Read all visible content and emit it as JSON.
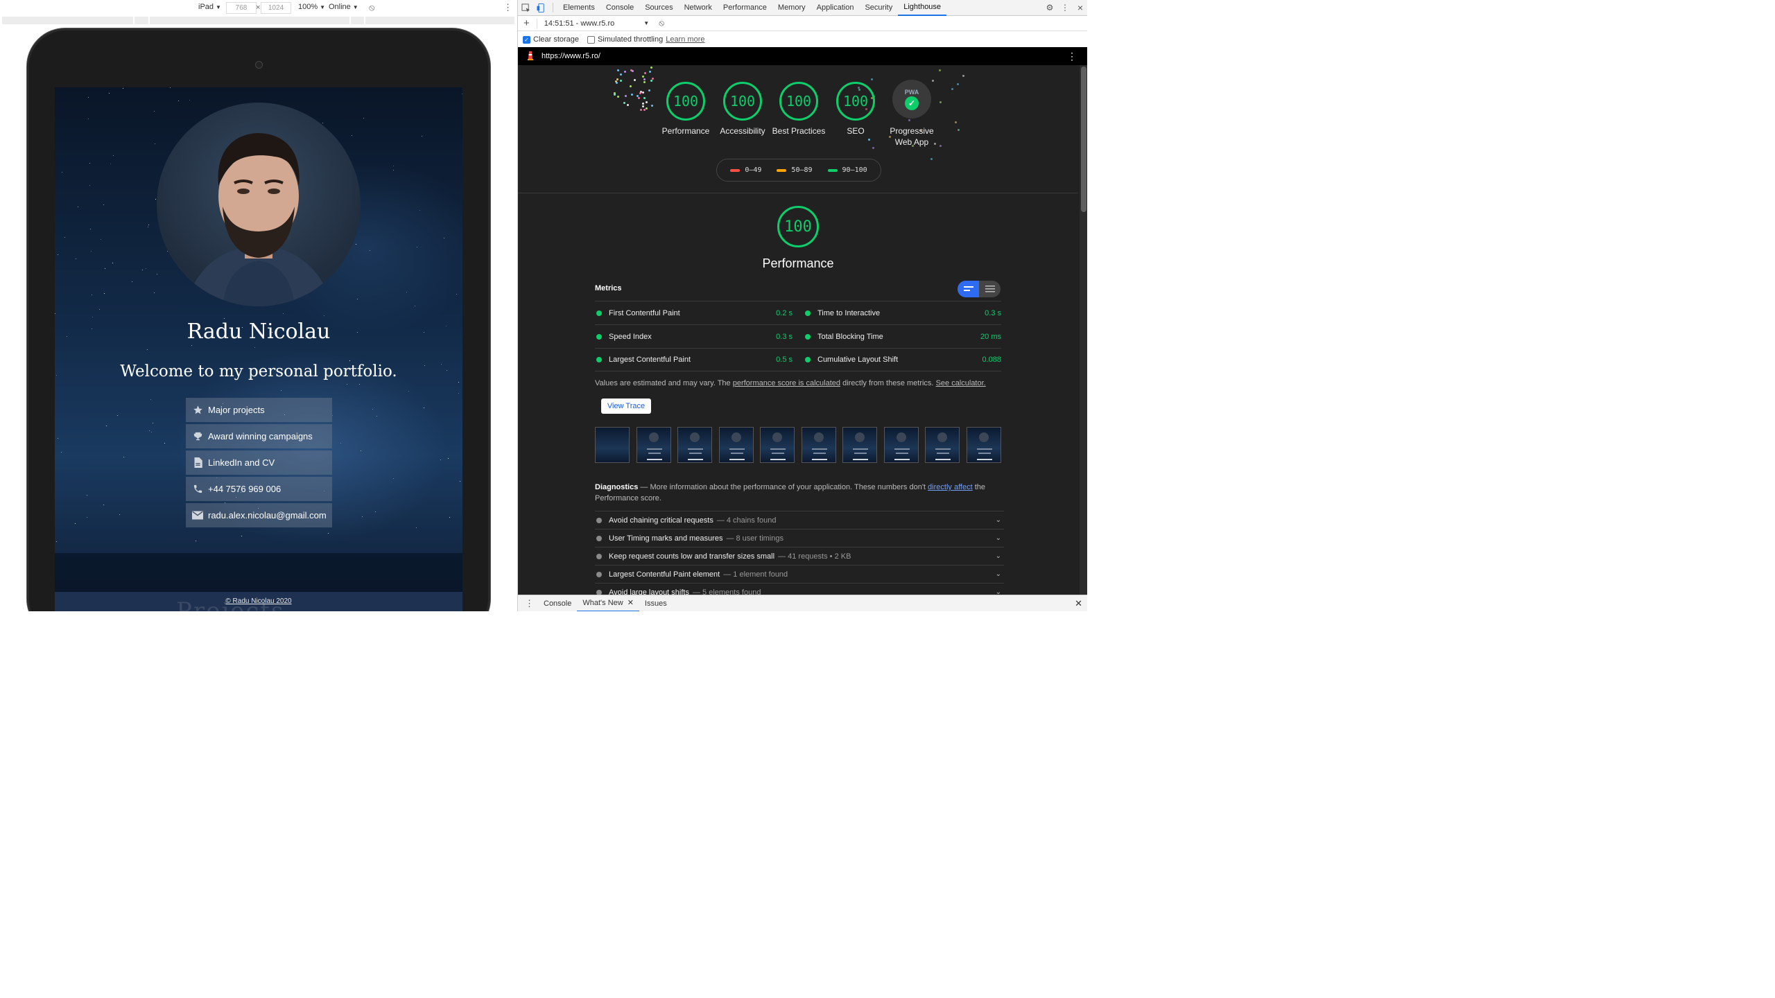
{
  "device_toolbar": {
    "device": "iPad",
    "width": "768",
    "times": "×",
    "height": "1024",
    "zoom": "100%",
    "network": "Online"
  },
  "site": {
    "name": "Radu Nicolau",
    "welcome": "Welcome to my personal portfolio.",
    "links": [
      {
        "label": "Major projects",
        "icon": "star-icon"
      },
      {
        "label": "Award winning campaigns",
        "icon": "trophy-icon"
      },
      {
        "label": "LinkedIn and CV",
        "icon": "document-icon"
      },
      {
        "label": "+44 7576 969 006",
        "icon": "phone-icon"
      },
      {
        "label": "radu.alex.nicolau@gmail.com",
        "icon": "mail-icon"
      }
    ],
    "footer": "© Radu Nicolau 2020",
    "footer_ghost": "Projects"
  },
  "devtools": {
    "tabs": [
      "Elements",
      "Console",
      "Sources",
      "Network",
      "Performance",
      "Memory",
      "Application",
      "Security",
      "Lighthouse"
    ],
    "active_tab": "Lighthouse",
    "report_select": "14:51:51 - www.r5.ro",
    "options": {
      "clear_storage": "Clear storage",
      "clear_storage_checked": true,
      "simulated_throttling": "Simulated throttling",
      "simulated_throttling_checked": false,
      "learn_more": "Learn more"
    },
    "report_url": "https://www.r5.ro/",
    "gauges": [
      {
        "label": "Performance",
        "score": "100"
      },
      {
        "label": "Accessibility",
        "score": "100"
      },
      {
        "label": "Best Practices",
        "score": "100"
      },
      {
        "label": "SEO",
        "score": "100"
      }
    ],
    "pwa": {
      "label": "Progressive Web App",
      "badge": "PWA"
    },
    "legend": [
      {
        "range": "0–49",
        "color": "#ff4e42"
      },
      {
        "range": "50–89",
        "color": "#ffa400"
      },
      {
        "range": "90–100",
        "color": "#0cce6b"
      }
    ],
    "performance": {
      "score": "100",
      "title": "Performance",
      "metrics_heading": "Metrics",
      "metrics": [
        {
          "name": "First Contentful Paint",
          "value": "0.2 s"
        },
        {
          "name": "Time to Interactive",
          "value": "0.3 s"
        },
        {
          "name": "Speed Index",
          "value": "0.3 s"
        },
        {
          "name": "Total Blocking Time",
          "value": "20 ms"
        },
        {
          "name": "Largest Contentful Paint",
          "value": "0.5 s"
        },
        {
          "name": "Cumulative Layout Shift",
          "value": "0.088"
        }
      ],
      "note_prefix": "Values are estimated and may vary. The ",
      "note_link1": "performance score is calculated",
      "note_middle": " directly from these metrics. ",
      "note_link2": "See calculator.",
      "view_trace": "View Trace"
    },
    "diagnostics": {
      "title": "Diagnostics",
      "intro": " — More information about the performance of your application. These numbers don't ",
      "link": "directly affect",
      "outro": " the Performance score.",
      "audits": [
        {
          "title": "Avoid chaining critical requests",
          "detail": "— 4 chains found"
        },
        {
          "title": "User Timing marks and measures",
          "detail": "— 8 user timings"
        },
        {
          "title": "Keep request counts low and transfer sizes small",
          "detail": "— 41 requests • 2 KB"
        },
        {
          "title": "Largest Contentful Paint element",
          "detail": "— 1 element found"
        },
        {
          "title": "Avoid large layout shifts",
          "detail": "— 5 elements found"
        }
      ]
    },
    "drawer": {
      "tabs": [
        "Console",
        "What's New",
        "Issues"
      ],
      "active": "What's New"
    }
  }
}
